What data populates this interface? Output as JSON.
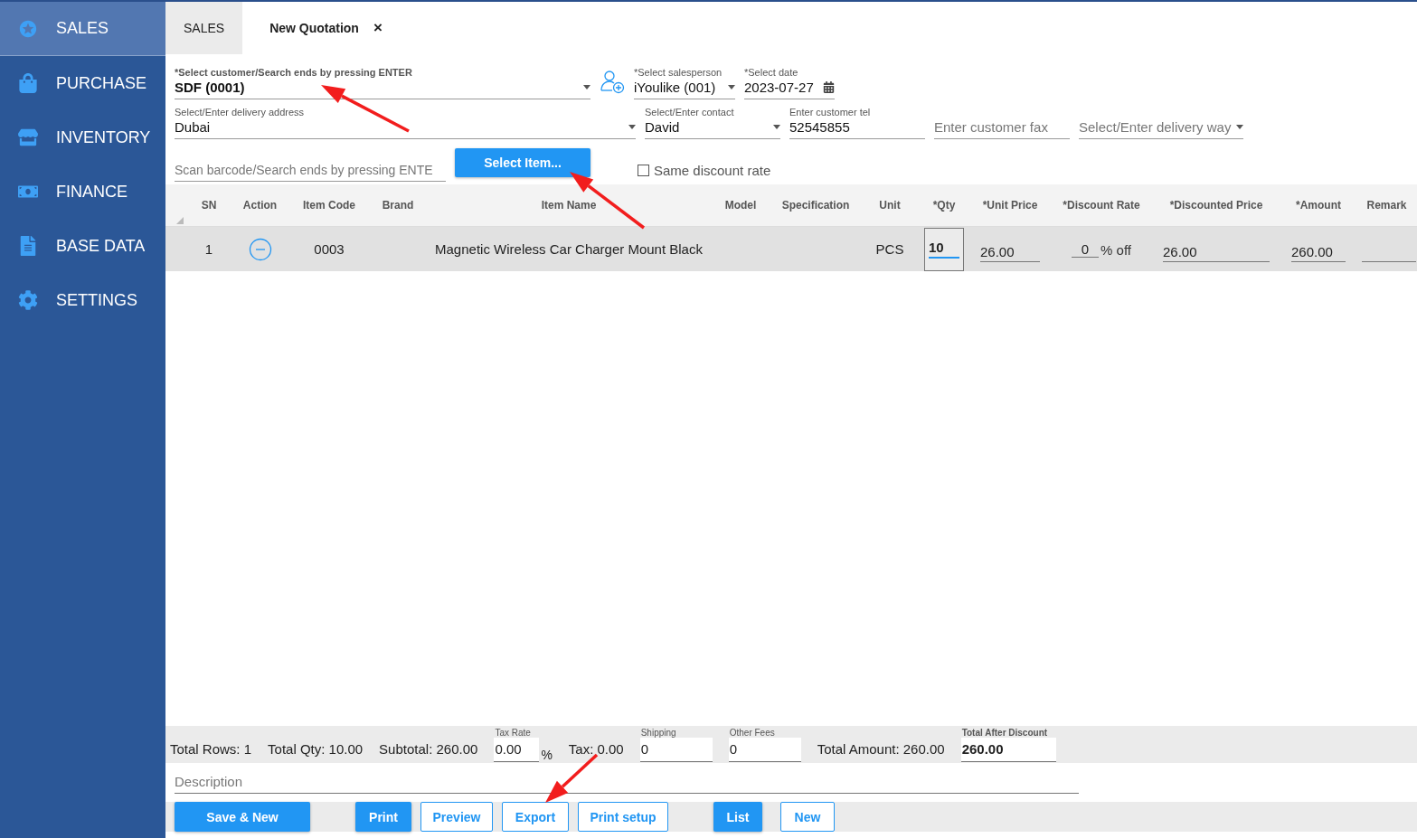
{
  "sidebar": {
    "items": [
      {
        "label": "SALES",
        "selected": true
      },
      {
        "label": "PURCHASE",
        "selected": false
      },
      {
        "label": "INVENTORY",
        "selected": false
      },
      {
        "label": "FINANCE",
        "selected": false
      },
      {
        "label": "BASE DATA",
        "selected": false
      },
      {
        "label": "SETTINGS",
        "selected": false
      }
    ]
  },
  "tabs": [
    {
      "label": "SALES",
      "selected": false
    },
    {
      "label": "New Quotation",
      "selected": true,
      "close": "×"
    }
  ],
  "form": {
    "customer": {
      "label": "*Select customer/Search ends by pressing ENTER",
      "value": "SDF (0001)"
    },
    "salesperson": {
      "label": "*Select salesperson",
      "value": "iYoulike (001)"
    },
    "date": {
      "label": "*Select date",
      "value": "2023-07-27"
    },
    "address": {
      "label": "Select/Enter delivery address",
      "value": "Dubai"
    },
    "contact": {
      "label": "Select/Enter contact",
      "value": "David"
    },
    "tel": {
      "label": "Enter customer tel",
      "value": "52545855"
    },
    "fax": {
      "placeholder": "Enter customer fax"
    },
    "delivery_way": {
      "placeholder": "Select/Enter delivery way"
    },
    "scan": {
      "placeholder": "Scan barcode/Search ends by pressing ENTE"
    },
    "select_item_button": "Select Item...",
    "same_discount": {
      "label": "Same discount rate",
      "checked": false
    }
  },
  "table": {
    "columns": [
      "SN",
      "Action",
      "Item Code",
      "Brand",
      "Item Name",
      "Model",
      "Specification",
      "Unit",
      "*Qty",
      "*Unit Price",
      "*Discount Rate",
      "*Discounted Price",
      "*Amount",
      "Remark"
    ],
    "rows": [
      {
        "cells": [
          {
            "kind": "text",
            "value": "1"
          },
          {
            "kind": "remove"
          },
          {
            "kind": "text",
            "value": "0003"
          },
          {
            "kind": "text"
          },
          {
            "kind": "text",
            "value": "Magnetic Wireless Car Charger Mount Black"
          },
          {
            "kind": "text"
          },
          {
            "kind": "text"
          },
          {
            "kind": "text",
            "value": "PCS"
          },
          {
            "kind": "qty",
            "value": "10"
          },
          {
            "kind": "field",
            "value": "26.00"
          },
          {
            "kind": "discount",
            "value": "0",
            "suffix": "% off"
          },
          {
            "kind": "field",
            "value": "26.00"
          },
          {
            "kind": "field",
            "value": "260.00"
          },
          {
            "kind": "field"
          }
        ]
      }
    ]
  },
  "totals": [
    {
      "kind": "text",
      "value": "Total Rows: 1"
    },
    {
      "kind": "text",
      "value": "Total Qty: 10.00"
    },
    {
      "kind": "text",
      "value": "Subtotal: 260.00"
    },
    {
      "kind": "input",
      "label": "Tax Rate",
      "value": "0.00",
      "suffix": "%"
    },
    {
      "kind": "text",
      "value": "Tax: 0.00"
    },
    {
      "kind": "input",
      "label": "Shipping",
      "value": "0"
    },
    {
      "kind": "input",
      "label": "Other Fees",
      "value": "0"
    },
    {
      "kind": "text",
      "value": "Total Amount:  260.00"
    },
    {
      "kind": "strong",
      "label": "Total After Discount",
      "value": "260.00"
    }
  ],
  "description": {
    "placeholder": "Description"
  },
  "buttons": [
    {
      "label": "Save & New",
      "kind": "primary"
    },
    {
      "label": "Print",
      "kind": "primary"
    },
    {
      "label": "Preview",
      "kind": "secondary"
    },
    {
      "label": "Export",
      "kind": "secondary"
    },
    {
      "label": "Print setup",
      "kind": "secondary"
    },
    {
      "label": "List",
      "kind": "primary"
    },
    {
      "label": "New",
      "kind": "secondary"
    }
  ]
}
